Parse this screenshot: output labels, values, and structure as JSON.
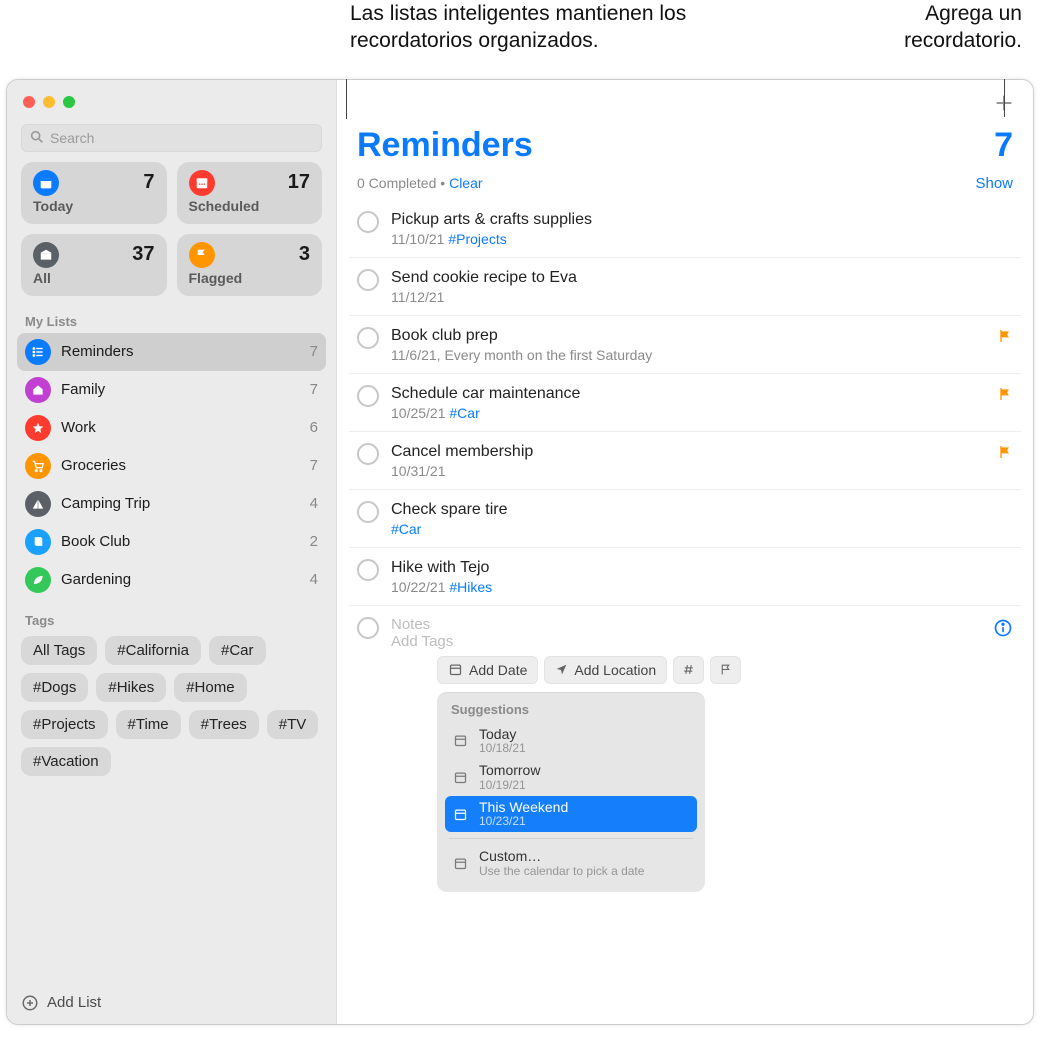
{
  "callouts": {
    "left": "Las listas inteligentes mantienen los recordatorios organizados.",
    "right": "Agrega un recordatorio."
  },
  "search": {
    "placeholder": "Search"
  },
  "smart": [
    {
      "id": "today",
      "label": "Today",
      "count": 7,
      "color": "#0a7aff"
    },
    {
      "id": "scheduled",
      "label": "Scheduled",
      "count": 17,
      "color": "#ff3b30"
    },
    {
      "id": "all",
      "label": "All",
      "count": 37,
      "color": "#5b6066"
    },
    {
      "id": "flagged",
      "label": "Flagged",
      "count": 3,
      "color": "#ff9500"
    }
  ],
  "lists_header": "My Lists",
  "lists": [
    {
      "name": "Reminders",
      "count": 7,
      "color": "#0a7aff",
      "icon": "list",
      "selected": true
    },
    {
      "name": "Family",
      "count": 7,
      "color": "#c13fd1",
      "icon": "home"
    },
    {
      "name": "Work",
      "count": 6,
      "color": "#ff3b30",
      "icon": "star"
    },
    {
      "name": "Groceries",
      "count": 7,
      "color": "#ff9500",
      "icon": "cart"
    },
    {
      "name": "Camping Trip",
      "count": 4,
      "color": "#5b6066",
      "icon": "tent"
    },
    {
      "name": "Book Club",
      "count": 2,
      "color": "#1aa0ff",
      "icon": "book"
    },
    {
      "name": "Gardening",
      "count": 4,
      "color": "#34c759",
      "icon": "leaf"
    }
  ],
  "tags_header": "Tags",
  "tags": [
    "All Tags",
    "#California",
    "#Car",
    "#Dogs",
    "#Hikes",
    "#Home",
    "#Projects",
    "#Time",
    "#Trees",
    "#TV",
    "#Vacation"
  ],
  "addlist_label": "Add List",
  "main": {
    "title": "Reminders",
    "count": 7,
    "completed_text": "0 Completed",
    "dot": "•",
    "clear": "Clear",
    "show": "Show",
    "items": [
      {
        "title": "Pickup arts & crafts supplies",
        "sub": "11/10/21 ",
        "tag": "#Projects"
      },
      {
        "title": "Send cookie recipe to Eva",
        "sub": "11/12/21"
      },
      {
        "title": "Book club prep",
        "sub": "11/6/21, Every month on the first Saturday",
        "flag": true
      },
      {
        "title": "Schedule car maintenance",
        "sub": "10/25/21 ",
        "tag": "#Car",
        "flag": true
      },
      {
        "title": "Cancel membership",
        "sub": "10/31/21",
        "flag": true
      },
      {
        "title": "Check spare tire",
        "sub": "",
        "tag": "#Car"
      },
      {
        "title": "Hike with Tejo",
        "sub": "10/22/21 ",
        "tag": "#Hikes"
      }
    ],
    "editor": {
      "notes_placeholder": "Notes",
      "addtags_placeholder": "Add Tags",
      "add_date": "Add Date",
      "add_location": "Add Location",
      "suggestions_label": "Suggestions",
      "suggestions": [
        {
          "l1": "Today",
          "l2": "10/18/21"
        },
        {
          "l1": "Tomorrow",
          "l2": "10/19/21"
        },
        {
          "l1": "This Weekend",
          "l2": "10/23/21",
          "selected": true
        },
        {
          "l1": "Custom…",
          "l2": "Use the calendar to pick a date",
          "sep_before": true
        }
      ]
    }
  }
}
